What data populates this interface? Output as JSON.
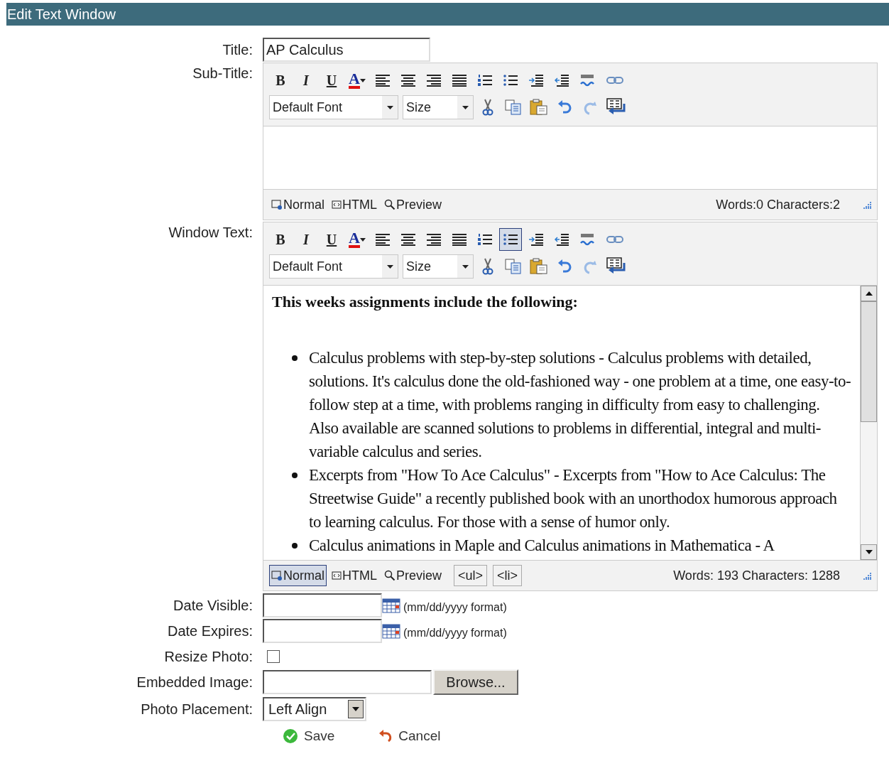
{
  "window": {
    "title": "Edit Text Window"
  },
  "title_field": {
    "label": "Title:",
    "value": "AP Calculus"
  },
  "editors": [
    {
      "label": "Sub-Title:",
      "tools": [
        {
          "kind": "bold",
          "label": "B",
          "selected": false
        },
        {
          "kind": "italic",
          "label": "I",
          "selected": false
        },
        {
          "kind": "underline",
          "label": "U",
          "selected": false
        },
        {
          "kind": "font-color",
          "label": "A",
          "selected": false
        },
        {
          "kind": "align-left",
          "selected": false
        },
        {
          "kind": "align-center",
          "selected": false
        },
        {
          "kind": "align-right",
          "selected": false
        },
        {
          "kind": "justify",
          "selected": false
        },
        {
          "kind": "ordered-list",
          "selected": false
        },
        {
          "kind": "unordered-list",
          "selected": false
        },
        {
          "kind": "indent",
          "selected": false
        },
        {
          "kind": "outdent",
          "selected": false
        },
        {
          "kind": "spellcheck",
          "selected": false
        },
        {
          "kind": "link",
          "selected": false
        }
      ],
      "font": "Default Font",
      "size": "Size",
      "actions": [
        {
          "kind": "cut"
        },
        {
          "kind": "copy"
        },
        {
          "kind": "paste"
        },
        {
          "kind": "undo"
        },
        {
          "kind": "redo"
        },
        {
          "kind": "line-break"
        }
      ],
      "modes": [
        {
          "kind": "normal",
          "label": "Normal",
          "selected": false
        },
        {
          "kind": "html",
          "label": "HTML",
          "selected": false
        },
        {
          "kind": "preview",
          "label": "Preview",
          "selected": false
        }
      ],
      "counts": "Words:0 Characters:2"
    },
    {
      "label": "Window Text:",
      "tools": [
        {
          "kind": "bold",
          "label": "B",
          "selected": false
        },
        {
          "kind": "italic",
          "label": "I",
          "selected": false
        },
        {
          "kind": "underline",
          "label": "U",
          "selected": false
        },
        {
          "kind": "font-color",
          "label": "A",
          "selected": false
        },
        {
          "kind": "align-left",
          "selected": false
        },
        {
          "kind": "align-center",
          "selected": false
        },
        {
          "kind": "align-right",
          "selected": false
        },
        {
          "kind": "justify",
          "selected": false
        },
        {
          "kind": "ordered-list",
          "selected": false
        },
        {
          "kind": "unordered-list",
          "selected": true
        },
        {
          "kind": "indent",
          "selected": false
        },
        {
          "kind": "outdent",
          "selected": false
        },
        {
          "kind": "spellcheck",
          "selected": false
        },
        {
          "kind": "link",
          "selected": false
        }
      ],
      "font": "Default Font",
      "size": "Size",
      "actions": [
        {
          "kind": "cut"
        },
        {
          "kind": "copy"
        },
        {
          "kind": "paste"
        },
        {
          "kind": "undo"
        },
        {
          "kind": "redo"
        },
        {
          "kind": "line-break"
        }
      ],
      "content": {
        "heading": "This weeks assignments include the following:",
        "items": [
          "Calculus problems with step-by-step solutions - Calculus problems with detailed, solutions. It's calculus done the old-fashioned way - one problem at a time, one easy-to-follow step at a time, with problems ranging in difficulty from easy to challenging. Also available are scanned solutions to problems in differential, integral and multi-variable calculus and series.",
          "Excerpts from \"How To Ace Calculus\" - Excerpts from \"How to Ace Calculus: The Streetwise Guide\" a recently published book with an unorthodox humorous approach to learning calculus. For those with a sense of humor only.",
          "Calculus animations in Maple and Calculus animations in Mathematica - A"
        ]
      },
      "modes": [
        {
          "kind": "normal",
          "label": "Normal",
          "selected": true
        },
        {
          "kind": "html",
          "label": "HTML",
          "selected": false
        },
        {
          "kind": "preview",
          "label": "Preview",
          "selected": false
        }
      ],
      "tags": [
        "<ul>",
        "<li>"
      ],
      "counts": "Words: 193 Characters: 1288"
    }
  ],
  "date_fields": [
    {
      "label": "Date Visible:",
      "hint": "(mm/dd/yyyy format)"
    },
    {
      "label": "Date Expires:",
      "hint": "(mm/dd/yyyy format)"
    }
  ],
  "resize_photo": {
    "label": "Resize Photo:",
    "checked": false
  },
  "embedded_image": {
    "label": "Embedded Image:",
    "button": "Browse..."
  },
  "photo_placement": {
    "label": "Photo Placement:",
    "value": "Left Align"
  },
  "buttons": [
    {
      "kind": "save",
      "label": "Save"
    },
    {
      "kind": "cancel",
      "label": "Cancel"
    }
  ]
}
